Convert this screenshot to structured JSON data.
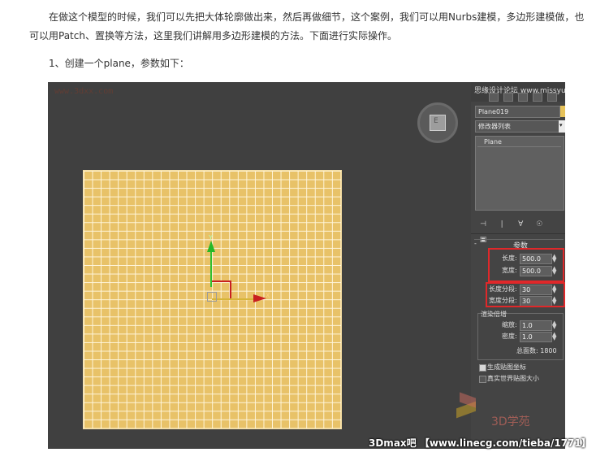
{
  "article": {
    "paragraph": "在做这个模型的时候，我们可以先把大体轮廓做出来，然后再做细节，这个案例，我们可以用Nurbs建模，多边形建模做，也可以用Patch、置换等方法，这里我们讲解用多边形建模的方法。下面进行实际操作。",
    "step1": "1、创建一个plane，参数如下："
  },
  "viewport": {
    "watermark_top": "www.3dxx.com",
    "viewcube_label": "E",
    "gizmo_y": "Y",
    "gizmo_x": "X",
    "plane_color": "#e8c268"
  },
  "panel": {
    "top_title": "思缘设计论坛 www.missyuan.com",
    "object_name": "Plane019",
    "modifier_list": "修改器列表",
    "modifier_dropdown_glyph": "▾",
    "stack_item": "Plane",
    "tools": [
      "⊣",
      "|",
      "∀",
      "☉",
      "▣"
    ],
    "rollout_minus": "-",
    "rollout_title": "参数",
    "length_label": "长度:",
    "length_value": "500.0",
    "width_label": "宽度:",
    "width_value": "500.0",
    "length_segs_label": "长度分段:",
    "length_segs_value": "30",
    "width_segs_label": "宽度分段:",
    "width_segs_value": "30",
    "render_group_title": "渲染倍增",
    "scale_label": "缩放:",
    "scale_value": "1.0",
    "density_label": "密度:",
    "density_value": "1.0",
    "total_faces": "总面数: 1800",
    "gen_mapping_label": "生成贴图坐标",
    "real_world_label": "真实世界贴图大小",
    "highlight_color": "#e0282a"
  },
  "watermark": {
    "site": "3D学苑",
    "caption": "3Dmax吧 【www.linecg.com/tieba/1771】"
  }
}
